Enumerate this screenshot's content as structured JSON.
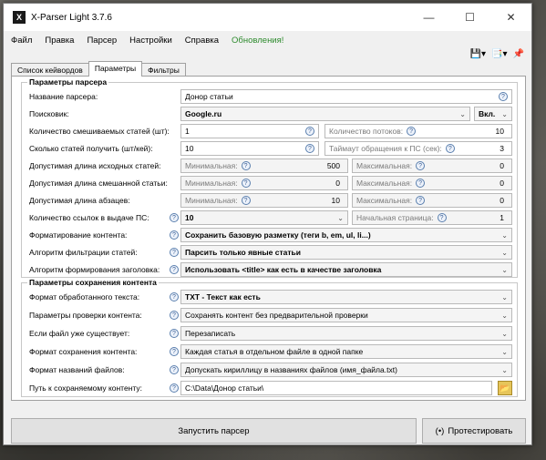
{
  "window": {
    "title": "X-Parser Light 3.7.6",
    "icon": "X"
  },
  "menu": [
    "Файл",
    "Правка",
    "Парсер",
    "Настройки",
    "Справка"
  ],
  "menu_update": "Обновления!",
  "tabs": [
    "Список кейвордов",
    "Параметры",
    "Фильтры"
  ],
  "parser_group": {
    "title": "Параметры парсера",
    "name_label": "Название парсера:",
    "name_value": "Донор статьи",
    "search_label": "Поисковик:",
    "search_value": "Google.ru",
    "search_toggle": "Вкл.",
    "mix_label": "Количество смешиваемых статей (шт):",
    "mix_value": "1",
    "threads_label": "Количество потоков:",
    "threads_value": "10",
    "get_label": "Сколько статей получить (шт/кей):",
    "get_value": "10",
    "timeout_label": "Таймаут обращения к ПС (сек):",
    "timeout_value": "3",
    "src_len_label": "Допустимая длина исходных статей:",
    "mixed_len_label": "Допустимая длина смешанной статьи:",
    "par_len_label": "Допустимая длина абзацев:",
    "min_ph": "Минимальная:",
    "max_ph": "Максимальная:",
    "src_min": "500",
    "src_max": "0",
    "mixed_min": "0",
    "mixed_max": "0",
    "par_min": "10",
    "par_max": "0",
    "links_label": "Количество ссылок в выдаче ПС:",
    "links_value": "10",
    "start_page_label": "Начальная страница:",
    "start_page_value": "1",
    "format_label": "Форматирование контента:",
    "format_value": "Сохранить базовую разметку (теги b, em, ul, li...)",
    "filter_label": "Алгоритм фильтрации статей:",
    "filter_value": "Парсить только явные статьи",
    "heading_label": "Алгоритм формирования заголовка:",
    "heading_value": "Использовать <title> как есть в качестве заголовка"
  },
  "save_group": {
    "title": "Параметры сохранения контента",
    "text_format_label": "Формат обработанного текста:",
    "text_format_value": "TXT - Текст как есть",
    "check_label": "Параметры проверки контента:",
    "check_value": "Сохранять контент без предварительной проверки",
    "exists_label": "Если файл уже существует:",
    "exists_value": "Перезаписать",
    "save_format_label": "Формат сохранения контента:",
    "save_format_value": "Каждая статья в отдельном файле в одной папке",
    "names_label": "Формат названий файлов:",
    "names_value": "Допускать кириллицу в названиях файлов (имя_файла.txt)",
    "path_label": "Путь к сохраняемому контенту:",
    "path_value": "C:\\Data\\Донор статьи\\"
  },
  "buttons": {
    "run": "Запустить парсер",
    "test": "Протестировать",
    "test_icon": "(•)"
  }
}
